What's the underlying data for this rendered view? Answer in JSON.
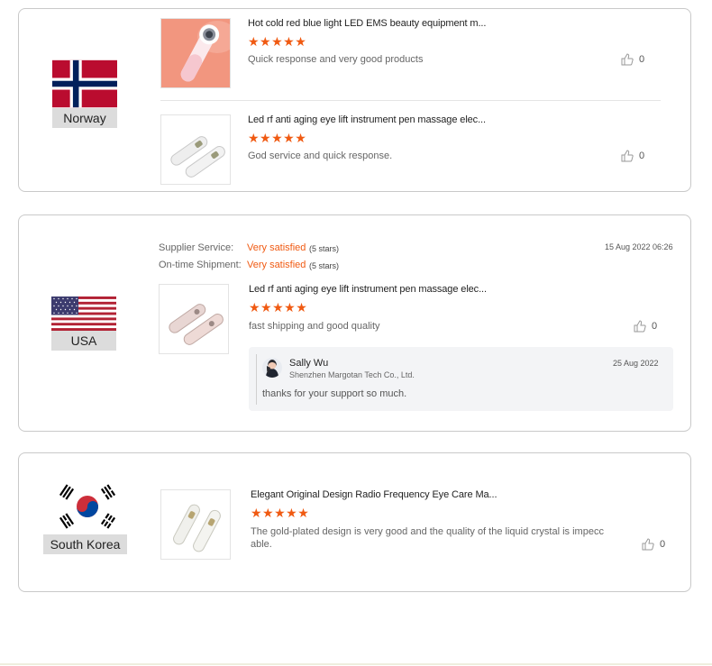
{
  "colors": {
    "accent": "#f05a12",
    "border": "#c9c9c9",
    "reply_bg": "#f3f4f6"
  },
  "reviews": [
    {
      "country": "Norway",
      "items": [
        {
          "title": "Hot cold red blue light LED EMS beauty equipment m...",
          "rating": 5,
          "stars": "★★★★★",
          "text": "Quick response and very good products",
          "likes": "0",
          "image": "pink-device"
        },
        {
          "title": "Led rf anti aging eye lift instrument pen massage elec...",
          "rating": 5,
          "stars": "★★★★★",
          "text": "God service and quick response.",
          "likes": "0",
          "image": "white-pens"
        }
      ]
    },
    {
      "country": "USA",
      "supplier_service_label": "Supplier Service:",
      "supplier_service_value": "Very satisfied",
      "supplier_service_note": "(5 stars)",
      "shipment_label": "On-time Shipment:",
      "shipment_value": "Very satisfied",
      "shipment_note": "(5 stars)",
      "date": "15 Aug 2022 06:26",
      "item": {
        "title": "Led rf anti aging eye lift instrument pen massage elec...",
        "rating": 5,
        "stars": "★★★★★",
        "text": "fast shipping and good quality",
        "likes": "0",
        "image": "rose-pens"
      },
      "reply": {
        "name": "Sally Wu",
        "company": "Shenzhen Margotan Tech Co., Ltd.",
        "date": "25 Aug 2022",
        "text": "thanks for your support so much."
      }
    },
    {
      "country": "South Korea",
      "item": {
        "title": "Elegant Original Design Radio Frequency Eye Care Ma...",
        "rating": 5,
        "stars": "★★★★★",
        "text_line1": "The gold-plated design is very good and the quality of the liquid crystal is impecc",
        "text_line2": "able.",
        "likes": "0",
        "image": "white-pens"
      }
    }
  ]
}
